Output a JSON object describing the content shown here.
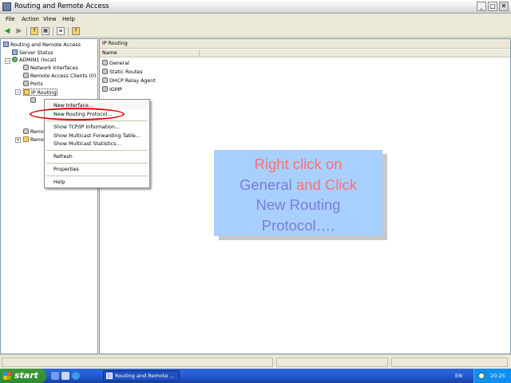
{
  "window": {
    "title": "Routing and Remote Access",
    "minimize": "_",
    "maximize": "□",
    "close": "✕"
  },
  "menubar": [
    "File",
    "Action",
    "View",
    "Help"
  ],
  "toolbar": {
    "back_icon": "back-arrow-icon",
    "forward_icon": "forward-arrow-icon",
    "buttons": [
      "up-folder-icon",
      "show-hide-tree-icon",
      "export-list-icon",
      "help-icon"
    ]
  },
  "tree": {
    "root": "Routing and Remote Access",
    "server_status": "Server Status",
    "server": "ADMIN1 (local)",
    "network_interfaces": "Network Interfaces",
    "remote_access_clients": "Remote Access Clients (0)",
    "ports": "Ports",
    "ip_routing": "IP Routing",
    "remote1": "Remo",
    "remote2": "Remo",
    "expand_minus": "−",
    "expand_plus": "+"
  },
  "right_pane": {
    "title": "IP Routing",
    "column_name": "Name",
    "items": [
      "General",
      "Static Routes",
      "DHCP Relay Agent",
      "IGMP"
    ]
  },
  "context_menu": {
    "items": [
      "New Interface...",
      "New Routing Protocol...",
      "Show TCP/IP Information...",
      "Show Multicast Forwarding Table...",
      "Show Multicast Statistics...",
      "Refresh",
      "Properties",
      "Help"
    ]
  },
  "callout": {
    "line1": "Right click on",
    "line2a": "General",
    "line2b": "and Click",
    "line3": "New Routing",
    "line4": "Protocol…."
  },
  "taskbar": {
    "start": "start",
    "task": "Routing and Remote ...",
    "lang": "EN",
    "clock": "20:25"
  },
  "colors": {
    "callout_bg": "#a8d0ff",
    "callout_red": "#ff6f6f",
    "callout_blue": "#7b7bde",
    "annotation_ellipse": "#e00000"
  }
}
